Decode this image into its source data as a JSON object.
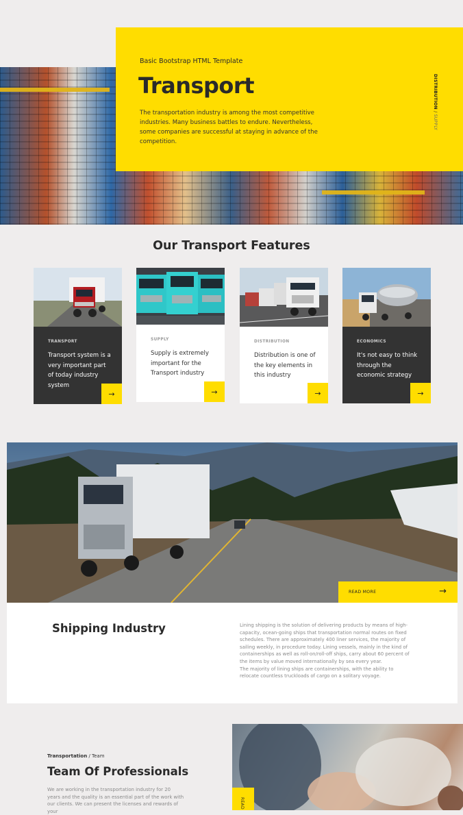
{
  "colors": {
    "accent": "#ffdd00",
    "dark_card": "#333333",
    "page_bg": "#efeded"
  },
  "hero": {
    "eyebrow": "Basic Bootstrap HTML Template",
    "title": "Transport",
    "text": "The transportation industry is among the most competitive industries. Many business battles to endure. Nevertheless, some companies are successful at staying in advance of the competition.",
    "side_label_bold": "DISTRIBUTION",
    "side_label_sep": " / ",
    "side_label_light": "SUPPLY"
  },
  "features": {
    "title": "Our Transport Features",
    "cards": [
      {
        "tag": "TRANSPORT",
        "text": "Transport system is a very important part of today industry system",
        "icon": "arrow-right-icon"
      },
      {
        "tag": "SUPPLY",
        "text": "Supply is extremely important for the Transport industry",
        "icon": "arrow-right-icon"
      },
      {
        "tag": "DISTRIBUTION",
        "text": "Distribution is one of the key elements in this industry",
        "icon": "arrow-right-icon"
      },
      {
        "tag": "ECONOMICS",
        "text": "It's not easy to think through the economic strategy",
        "icon": "arrow-right-icon"
      }
    ]
  },
  "shipping": {
    "read_more": "READ MORE",
    "title": "Shipping Industry",
    "text_1": "Lining shipping is the solution of delivering products by means of high-capacity, ocean-going ships that transportation normal routes on fixed schedules. There are approximately 400 liner services, the majority of sailing weekly, in procedure today. Lining vessels, mainly in the kind of containerships as well as roll-on/roll-off ships, carry about 60 percent of the items by value moved internationally by sea every year.",
    "text_2": "The majority of lining ships are containerships, with the ability to relocate countless truckloads of cargo on a solitary voyage."
  },
  "team": {
    "breadcrumb_bold": "Transportation",
    "breadcrumb_sep": " / ",
    "breadcrumb_rest": "Team",
    "title": "Team Of Professionals",
    "text": "We are working in the transportation industry for 20 years and the quality is an essential part of the work with our clients. We can present the licenses and rewards of your",
    "photo_tab": "READ"
  }
}
